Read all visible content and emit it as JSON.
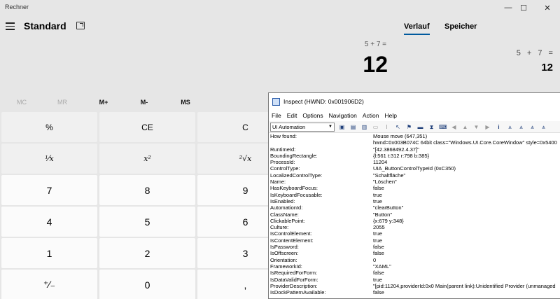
{
  "window": {
    "title": "Rechner",
    "minimize_glyph": "—",
    "maximize_glyph": "☐",
    "close_glyph": "✕"
  },
  "header": {
    "mode_title": "Standard",
    "menu_icon": "hamburger-icon",
    "keep_on_top_icon": "keep-on-top-icon"
  },
  "display": {
    "expression": "5 + 7 =",
    "result": "12"
  },
  "history_panel": {
    "tabs": [
      "Verlauf",
      "Speicher"
    ],
    "active_tab": "Verlauf",
    "entries": [
      {
        "expression": "5 + 7 =",
        "result": "12"
      }
    ]
  },
  "memory_buttons": [
    {
      "label": "MC",
      "enabled": false
    },
    {
      "label": "MR",
      "enabled": false
    },
    {
      "label": "M+",
      "enabled": true
    },
    {
      "label": "M-",
      "enabled": true
    },
    {
      "label": "MS",
      "enabled": true
    }
  ],
  "keys": {
    "percent": "%",
    "ce": "CE",
    "c": "C",
    "reciprocal": "¹⁄x",
    "square": "x²",
    "sqrt": "²√x",
    "seven": "7",
    "eight": "8",
    "nine": "9",
    "four": "4",
    "five": "5",
    "six": "6",
    "one": "1",
    "two": "2",
    "three": "3",
    "negate": "⁺⁄₋",
    "zero": "0",
    "decimal": ","
  },
  "inspect": {
    "title": "Inspect  (HWND: 0x001906D2)",
    "menu": [
      "File",
      "Edit",
      "Options",
      "Navigation",
      "Action",
      "Help"
    ],
    "mode_select": "UI Automation",
    "properties": [
      {
        "name": "How found:",
        "value": "Mouse move (647,351)"
      },
      {
        "name": "",
        "value": "hwnd=0x003B074C 64bit class=\"Windows.UI.Core.CoreWindow\" style=0x5400"
      },
      {
        "name": "RuntimeId:",
        "value": "\"[42.3868492.4.37]\""
      },
      {
        "name": "BoundingRectangle:",
        "value": "{l:561 t:312 r:798 b:385}"
      },
      {
        "name": "ProcessId:",
        "value": "11204"
      },
      {
        "name": "ControlType:",
        "value": "UIA_ButtonControlTypeId (0xC350)"
      },
      {
        "name": "LocalizedControlType:",
        "value": "\"Schaltfläche\""
      },
      {
        "name": "Name:",
        "value": "\"Löschen\""
      },
      {
        "name": "HasKeyboardFocus:",
        "value": "false"
      },
      {
        "name": "IsKeyboardFocusable:",
        "value": "true"
      },
      {
        "name": "IsEnabled:",
        "value": "true"
      },
      {
        "name": "AutomationId:",
        "value": "\"clearButton\""
      },
      {
        "name": "ClassName:",
        "value": "\"Button\""
      },
      {
        "name": "ClickablePoint:",
        "value": "{x:679 y:348}"
      },
      {
        "name": "Culture:",
        "value": "2055"
      },
      {
        "name": "IsControlElement:",
        "value": "true"
      },
      {
        "name": "IsContentElement:",
        "value": "true"
      },
      {
        "name": "IsPassword:",
        "value": "false"
      },
      {
        "name": "IsOffscreen:",
        "value": "false"
      },
      {
        "name": "Orientation:",
        "value": "0"
      },
      {
        "name": "FrameworkId:",
        "value": "\"XAML\""
      },
      {
        "name": "IsRequiredForForm:",
        "value": "false"
      },
      {
        "name": "IsDataValidForForm:",
        "value": "true"
      },
      {
        "name": "ProviderDescription:",
        "value": "\"[pid:11204,providerId:0x0 Main(parent link):Unidentified Provider (unmanaged"
      },
      {
        "name": "IsDockPatternAvailable:",
        "value": "false"
      }
    ]
  }
}
